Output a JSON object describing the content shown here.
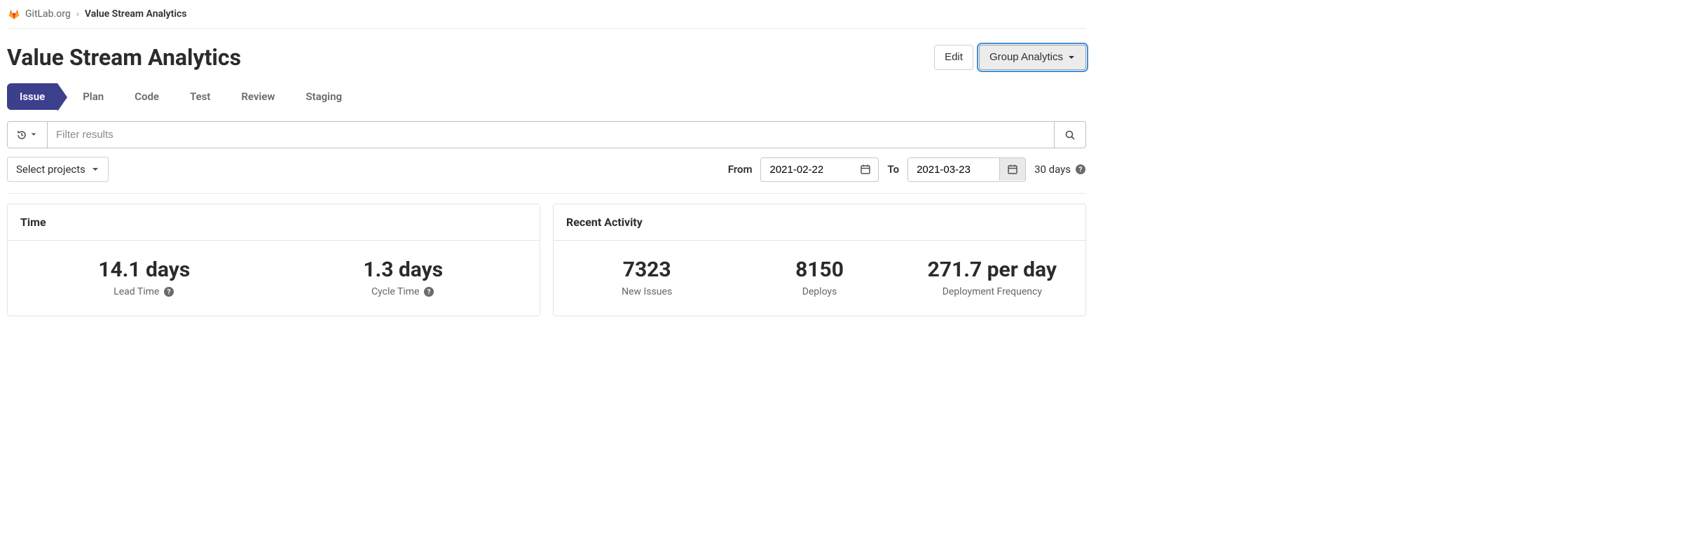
{
  "breadcrumb": {
    "org": "GitLab.org",
    "current": "Value Stream Analytics"
  },
  "header": {
    "title": "Value Stream Analytics",
    "edit_label": "Edit",
    "group_analytics_label": "Group Analytics"
  },
  "stages": {
    "active": "Issue",
    "items": [
      "Plan",
      "Code",
      "Test",
      "Review",
      "Staging"
    ]
  },
  "filter": {
    "placeholder": "Filter results"
  },
  "controls": {
    "select_projects_label": "Select projects",
    "from_label": "From",
    "from_value": "2021-02-22",
    "to_label": "To",
    "to_value": "2021-03-23",
    "days_summary": "30 days"
  },
  "cards": {
    "time": {
      "title": "Time",
      "metrics": [
        {
          "value": "14.1 days",
          "label": "Lead Time"
        },
        {
          "value": "1.3 days",
          "label": "Cycle Time"
        }
      ]
    },
    "activity": {
      "title": "Recent Activity",
      "metrics": [
        {
          "value": "7323",
          "label": "New Issues"
        },
        {
          "value": "8150",
          "label": "Deploys"
        },
        {
          "value": "271.7 per day",
          "label": "Deployment Frequency"
        }
      ]
    }
  }
}
